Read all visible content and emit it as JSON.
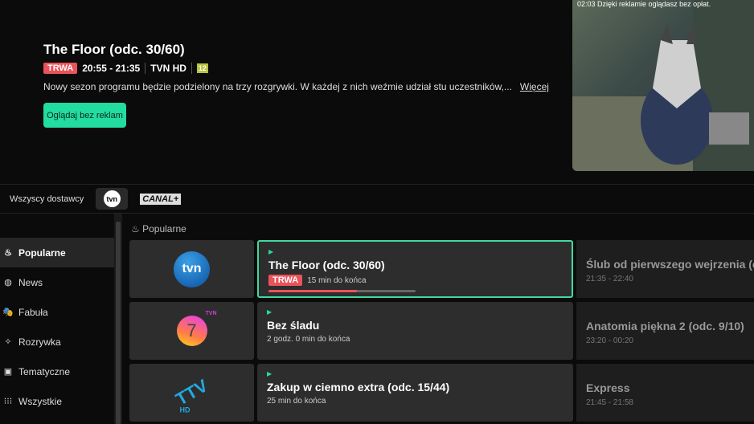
{
  "hero": {
    "title": "The Floor (odc. 30/60)",
    "badge": "TRWA",
    "time": "20:55 - 21:35",
    "channel": "TVN HD",
    "age": "12",
    "description": "Nowy sezon programu będzie podzielony na trzy rozgrywki. W każdej z nich weźmie udział stu uczestników,...",
    "more": "Więcej",
    "watch_button": "Oglądaj bez reklam"
  },
  "video": {
    "caption": "02:03 Dzięki reklamie oglądasz bez opłat."
  },
  "providers": {
    "all": "Wszyscy dostawcy",
    "tvn": "tvn",
    "canal": "CANAL+"
  },
  "sidebar": {
    "items": [
      {
        "label": "Popularne",
        "icon": "♨"
      },
      {
        "label": "News",
        "icon": "◍"
      },
      {
        "label": "Fabuła",
        "icon": "🎭"
      },
      {
        "label": "Rozrywka",
        "icon": "✧"
      },
      {
        "label": "Tematyczne",
        "icon": "▣"
      },
      {
        "label": "Wszystkie",
        "icon": "⁝⁝⁝"
      }
    ]
  },
  "section": {
    "title": "Popularne",
    "icon": "♨"
  },
  "rows": [
    {
      "channel": "tvn",
      "title": "The Floor (odc. 30/60)",
      "badge": "TRWA",
      "remaining": "15 min do końca",
      "progress": 0.6,
      "next_title": "Ślub od pierwszego wejrzenia (odc.",
      "next_time": "21:35 - 22:40"
    },
    {
      "channel": "7",
      "channel_sup": "TVN",
      "title": "Bez śladu",
      "remaining": "2 godz. 0 min do końca",
      "next_title": "Anatomia piękna 2 (odc. 9/10)",
      "next_time": "23:20 - 00:20"
    },
    {
      "channel": "TTV",
      "channel_sup": "HD",
      "title": "Zakup w ciemno extra (odc. 15/44)",
      "remaining": "25 min do końca",
      "next_title": "Express",
      "next_time": "21:45 - 21:58"
    }
  ],
  "colors": {
    "accent": "#22dca0",
    "live": "#e9535a"
  }
}
